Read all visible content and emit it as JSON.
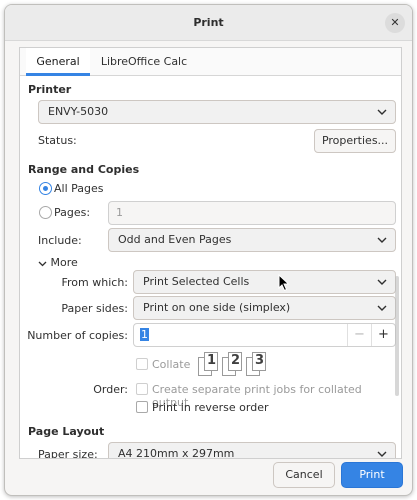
{
  "dialog": {
    "title": "Print",
    "close_glyph": "✕"
  },
  "tabs": [
    {
      "label": "General",
      "active": true
    },
    {
      "label": "LibreOffice Calc",
      "active": false
    }
  ],
  "printer": {
    "section": "Printer",
    "selected": "ENVY-5030",
    "status_label": "Status:",
    "properties_button": "Properties..."
  },
  "range": {
    "section": "Range and Copies",
    "all_pages_label": "All Pages",
    "pages_label": "Pages:",
    "pages_value": "1",
    "include_label": "Include:",
    "include_value": "Odd and Even Pages",
    "more_label": "More",
    "more_glyph": "⌄",
    "from_which_label": "From which:",
    "from_which_value": "Print Selected Cells",
    "paper_sides_label": "Paper sides:",
    "paper_sides_value": "Print on one side (simplex)",
    "copies_label": "Number of copies:",
    "copies_value": "1",
    "minus_glyph": "−",
    "plus_glyph": "+",
    "collate_label": "Collate",
    "order_label": "Order:",
    "separate_jobs_label": "Create separate print jobs for collated output",
    "reverse_order_label": "Print in reverse order",
    "collate_pages": [
      "1",
      "2",
      "3"
    ]
  },
  "layout": {
    "section": "Page Layout",
    "paper_size_label": "Paper size:",
    "paper_size_value": "A4 210mm x 297mm"
  },
  "footer": {
    "cancel": "Cancel",
    "print": "Print"
  },
  "icons": {
    "dropdown": "chevron-down-icon",
    "close": "close-icon",
    "cursor": "mouse-pointer-icon"
  },
  "colors": {
    "accent": "#3584e4"
  }
}
